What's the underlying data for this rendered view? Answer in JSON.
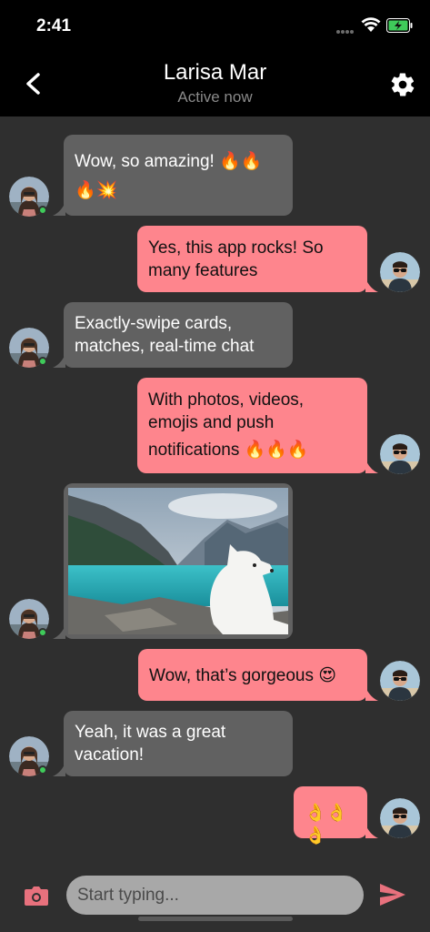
{
  "status_bar": {
    "time": "2:41"
  },
  "header": {
    "title": "Larisa Mar",
    "subtitle": "Active now"
  },
  "messages": [
    {
      "side": "in",
      "line1": "Wow, so amazing! 🔥🔥",
      "line2": "🔥💥"
    },
    {
      "side": "out",
      "line1": "Yes, this app rocks! So",
      "line2": "many features"
    },
    {
      "side": "in",
      "line1": "Exactly-swipe cards,",
      "line2": "matches, real-time chat"
    },
    {
      "side": "out",
      "line1": "With photos, videos,",
      "line2": "emojis and push",
      "line3": "notifications 🔥🔥🔥"
    },
    {
      "side": "in",
      "type": "photo"
    },
    {
      "side": "out",
      "line1": "Wow, that’s gorgeous 😍"
    },
    {
      "side": "in",
      "line1": "Yeah, it was a great",
      "line2": "vacation!"
    },
    {
      "side": "out",
      "line1": "👌👌👌"
    }
  ],
  "input": {
    "placeholder": "Start typing..."
  },
  "colors": {
    "background": "#2f2f2f",
    "incoming_bubble": "#616161",
    "outgoing_bubble": "#fe858d",
    "online": "#3fcb5a",
    "send_accent": "#e8717d"
  },
  "icons": {
    "back": "chevron-left-icon",
    "settings": "gear-icon",
    "camera": "camera-icon",
    "send": "send-icon",
    "wifi": "wifi-icon",
    "battery": "battery-charging-icon"
  }
}
